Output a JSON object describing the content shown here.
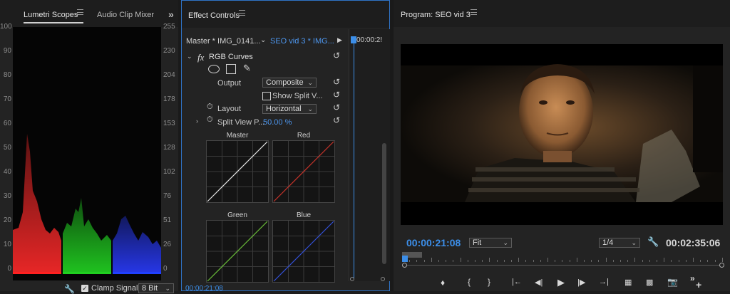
{
  "scopes": {
    "tab_active": "Lumetri Scopes",
    "tab_other": "Audio Clip Mixer: S",
    "overflow": "»",
    "left_ticks": [
      "100",
      "90",
      "80",
      "70",
      "60",
      "50",
      "40",
      "30",
      "20",
      "10",
      "0"
    ],
    "right_ticks": [
      "255",
      "230",
      "204",
      "178",
      "153",
      "128",
      "102",
      "76",
      "51",
      "26",
      "0"
    ],
    "footer": {
      "clamp_label": "Clamp Signal",
      "bit_value": "8 Bit",
      "clamp_checked": true
    }
  },
  "effects": {
    "tab": "Effect Controls",
    "master_clip": "Master * IMG_0141...",
    "seq_clip": "SEO vid 3 * IMG...",
    "timecode_top": "00:00:2!",
    "effect_name": "RGB Curves",
    "fx_badge": "fx",
    "output_label": "Output",
    "output_value": "Composite",
    "split_label": "Show Split V...",
    "split_checked": false,
    "layout_label": "Layout",
    "layout_value": "Horizontal",
    "split_view_label": "Split View P...",
    "split_view_value": "50.00 %",
    "curves": [
      "Master",
      "Red",
      "Green",
      "Blue"
    ],
    "curve_colors": [
      "#e8e8e8",
      "#c8342a",
      "#6cc23a",
      "#3350d8"
    ],
    "timecode_bottom": "00:00:21:08"
  },
  "program": {
    "title": "Program: SEO vid 3",
    "timecode": "00:00:21:08",
    "fit": "Fit",
    "quality": "1/4",
    "duration": "00:02:35:06"
  },
  "colors": {
    "accent": "#2f73c6",
    "timecode_blue": "#3c8ee8"
  }
}
